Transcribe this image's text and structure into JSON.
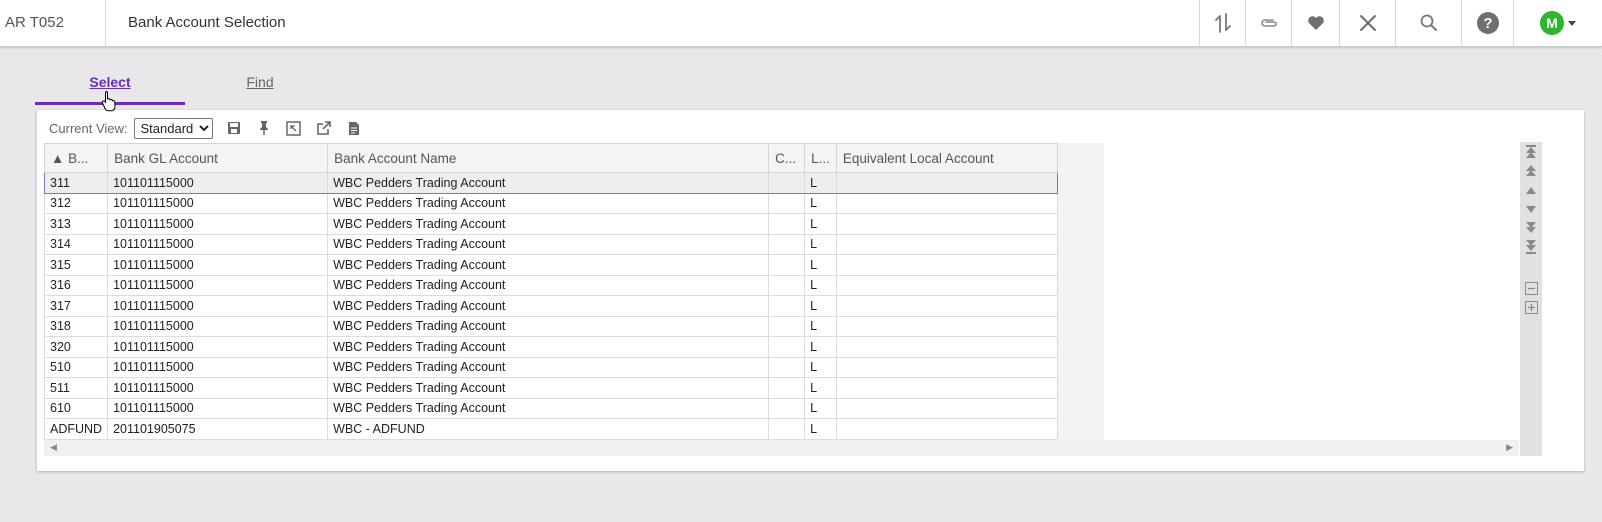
{
  "header": {
    "app_code": "AR T052",
    "title": "Bank Account Selection",
    "avatar_letter": "M",
    "avatar_color": "#2db52d"
  },
  "tabs": [
    {
      "label": "Select",
      "active": true
    },
    {
      "label": "Find",
      "active": false
    }
  ],
  "toolbar": {
    "current_view_label": "Current View:",
    "view_options": [
      "Standard"
    ],
    "selected_view": "Standard"
  },
  "grid": {
    "columns": [
      "▲ B...",
      "Bank GL Account",
      "Bank Account Name",
      "C...",
      "L...",
      "Equivalent Local Account"
    ],
    "rows": [
      [
        "311",
        "101101115000",
        "WBC Pedders Trading Account",
        "",
        "L",
        ""
      ],
      [
        "312",
        "101101115000",
        "WBC Pedders Trading Account",
        "",
        "L",
        ""
      ],
      [
        "313",
        "101101115000",
        "WBC Pedders Trading Account",
        "",
        "L",
        ""
      ],
      [
        "314",
        "101101115000",
        "WBC Pedders Trading Account",
        "",
        "L",
        ""
      ],
      [
        "315",
        "101101115000",
        "WBC Pedders Trading Account",
        "",
        "L",
        ""
      ],
      [
        "316",
        "101101115000",
        "WBC Pedders Trading Account",
        "",
        "L",
        ""
      ],
      [
        "317",
        "101101115000",
        "WBC Pedders Trading Account",
        "",
        "L",
        ""
      ],
      [
        "318",
        "101101115000",
        "WBC Pedders Trading Account",
        "",
        "L",
        ""
      ],
      [
        "320",
        "101101115000",
        "WBC Pedders Trading Account",
        "",
        "L",
        ""
      ],
      [
        "510",
        "101101115000",
        "WBC Pedders Trading Account",
        "",
        "L",
        ""
      ],
      [
        "511",
        "101101115000",
        "WBC Pedders Trading Account",
        "",
        "L",
        ""
      ],
      [
        "610",
        "101101115000",
        "WBC Pedders Trading Account",
        "",
        "L",
        ""
      ],
      [
        "ADFUND",
        "201101905075",
        "WBC - ADFUND",
        "",
        "L",
        ""
      ]
    ]
  },
  "colors": {
    "accent": "#6a2fc0",
    "selected_row_border": "#8a6cc9"
  }
}
